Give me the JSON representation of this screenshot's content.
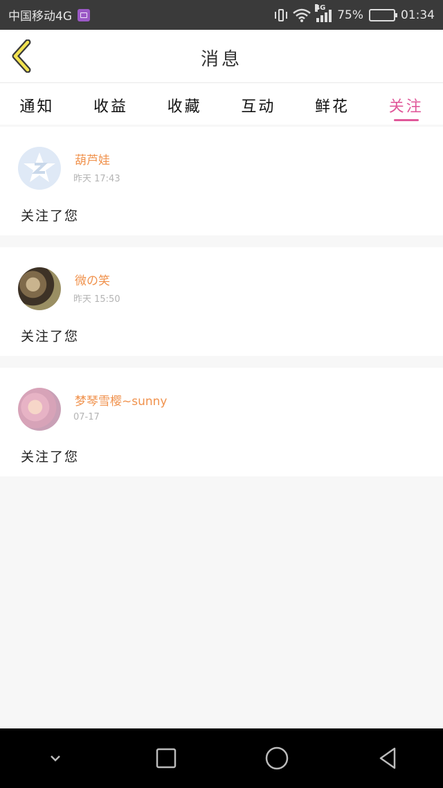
{
  "status_bar": {
    "carrier": "中国移动4G",
    "network": "4G",
    "battery": "75%",
    "battery_level": 0.75,
    "time": "01:34"
  },
  "header": {
    "title": "消息",
    "back_icon": "chevron-left-icon"
  },
  "tabs": [
    {
      "label": "通知",
      "active": false
    },
    {
      "label": "收益",
      "active": false
    },
    {
      "label": "收藏",
      "active": false
    },
    {
      "label": "互动",
      "active": false
    },
    {
      "label": "鲜花",
      "active": false
    },
    {
      "label": "关注",
      "active": true
    }
  ],
  "notifications": [
    {
      "name": "葫芦娃",
      "time": "昨天  17:43",
      "message": "关注了您"
    },
    {
      "name": "微の笑",
      "time": "昨天  15:50",
      "message": "关注了您"
    },
    {
      "name": "梦琴雪樱~sunny",
      "time": "07-17",
      "message": "关注了您"
    }
  ],
  "colors": {
    "accent": "#e0589a",
    "username": "#f0924d",
    "back_icon_fill": "#f2e250"
  },
  "nav_bar": [
    "chevron-down-icon",
    "square-icon",
    "circle-icon",
    "triangle-back-icon"
  ]
}
